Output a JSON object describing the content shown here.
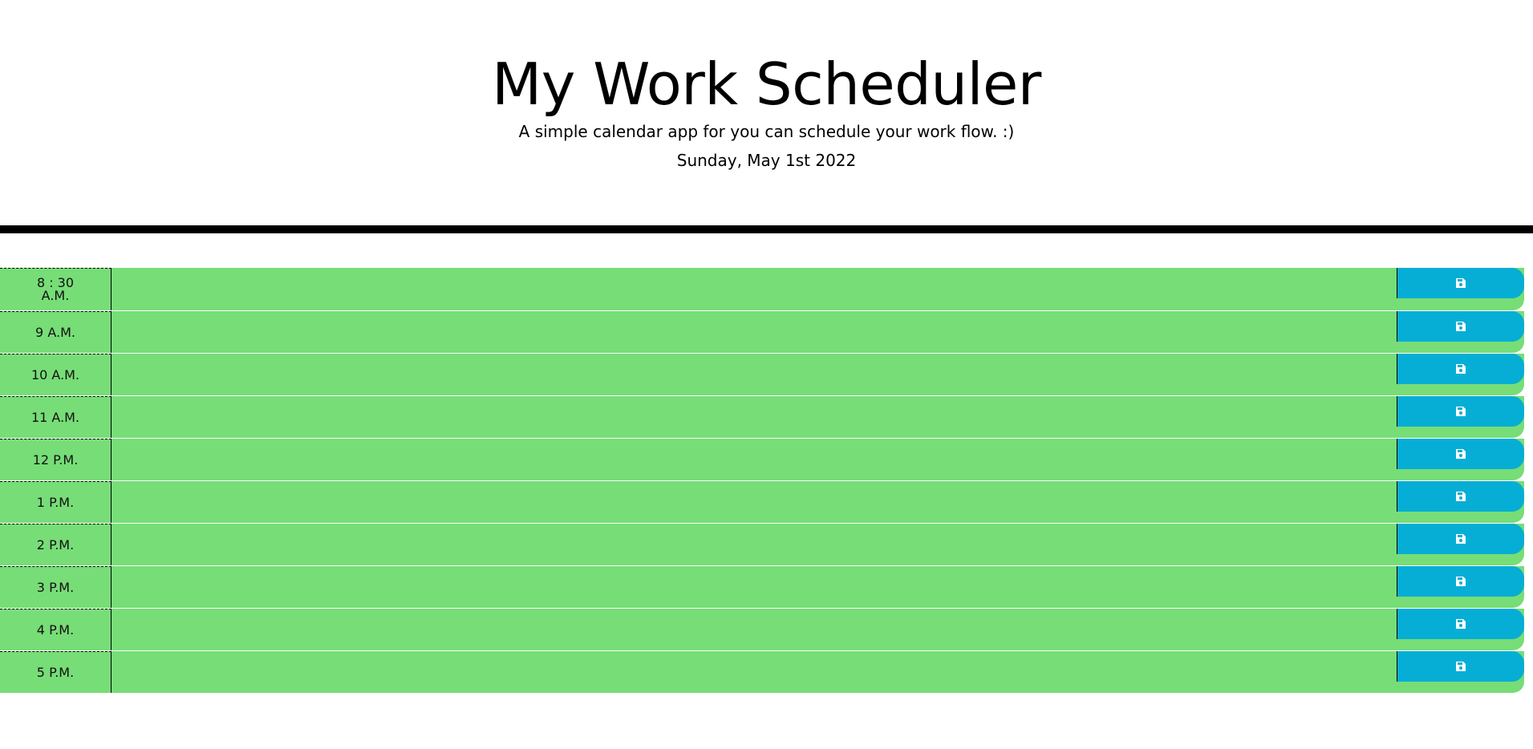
{
  "header": {
    "title": "My Work Scheduler",
    "subtitle": "A simple calendar app for you can schedule your work flow. :)",
    "current_date": "Sunday, May 1st 2022"
  },
  "colors": {
    "present": "#77dd77",
    "save_button": "#06aed5"
  },
  "timeblocks": [
    {
      "hour": "8 : 30 A.M.",
      "text": ""
    },
    {
      "hour": "9 A.M.",
      "text": ""
    },
    {
      "hour": "10 A.M.",
      "text": ""
    },
    {
      "hour": "11 A.M.",
      "text": ""
    },
    {
      "hour": "12 P.M.",
      "text": ""
    },
    {
      "hour": "1 P.M.",
      "text": ""
    },
    {
      "hour": "2 P.M.",
      "text": ""
    },
    {
      "hour": "3 P.M.",
      "text": ""
    },
    {
      "hour": "4 P.M.",
      "text": ""
    },
    {
      "hour": "5 P.M.",
      "text": ""
    }
  ],
  "save_icon": "floppy-disk-icon"
}
